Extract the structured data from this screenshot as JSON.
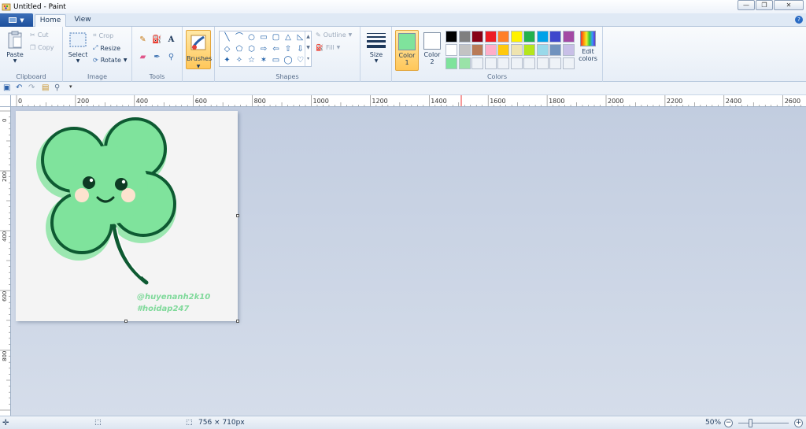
{
  "window": {
    "title": "Untitled - Paint",
    "buttons": {
      "minimize": "—",
      "maximize": "❐",
      "close": "✕"
    }
  },
  "tabs": [
    {
      "label": "Home",
      "active": true
    },
    {
      "label": "View",
      "active": false
    }
  ],
  "help_label": "?",
  "ribbon": {
    "clipboard": {
      "label": "Clipboard",
      "paste": "Paste",
      "cut": "Cut",
      "copy": "Copy"
    },
    "image": {
      "label": "Image",
      "select": "Select",
      "crop": "Crop",
      "resize": "Resize",
      "rotate": "Rotate"
    },
    "tools": {
      "label": "Tools",
      "text_tool": "A"
    },
    "brushes": {
      "label": "Brushes"
    },
    "shapes": {
      "label": "Shapes",
      "outline": "Outline",
      "fill": "Fill"
    },
    "size": {
      "label": "Size"
    },
    "color1": {
      "label": "Color",
      "num": "1",
      "value": "#7fe39c"
    },
    "color2": {
      "label": "Color",
      "num": "2",
      "value": "#ffffff"
    },
    "colors": {
      "label": "Colors",
      "edit_colors_line1": "Edit",
      "edit_colors_line2": "colors"
    }
  },
  "palette": {
    "row1": [
      "#000000",
      "#7f7f7f",
      "#880015",
      "#ed1c24",
      "#ff7f27",
      "#fff200",
      "#22b14c",
      "#00a2e8",
      "#3f48cc",
      "#a349a4"
    ],
    "row2": [
      "#ffffff",
      "#c3c3c3",
      "#b97a57",
      "#ffaec9",
      "#ffc90e",
      "#efe4b0",
      "#b5e61d",
      "#99d9ea",
      "#7092be",
      "#c8bfe7"
    ],
    "row3": [
      "#7fe39c",
      "#9ae3a8"
    ]
  },
  "ruler_h": [
    "0",
    "200",
    "400",
    "600",
    "800",
    "1000",
    "1200",
    "1400",
    "1600",
    "1800",
    "2000",
    "2200",
    "2400",
    "2600"
  ],
  "ruler_v": [
    "0",
    "200",
    "400",
    "600",
    "800"
  ],
  "watermark": {
    "line1": "@huyenanh2k10",
    "line2": "#hoidap247"
  },
  "status": {
    "dimensions": "756 × 710px",
    "zoom": "50%"
  }
}
